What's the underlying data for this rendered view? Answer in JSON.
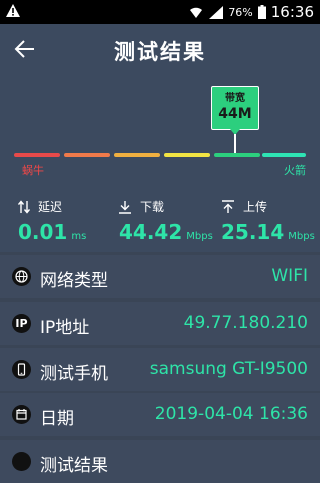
{
  "status_bar": {
    "battery": "76%",
    "time": "16:36"
  },
  "app_bar": {
    "title": "测试结果"
  },
  "gauge": {
    "bubble_label": "带宽",
    "bubble_value": "44M",
    "left_label": "蜗牛",
    "right_label": "火箭",
    "segment_colors": [
      "#e84a4a",
      "#f07a4a",
      "#f0b040",
      "#f2e443",
      "#2ccf7e",
      "#2ee4b4"
    ]
  },
  "stats": {
    "latency": {
      "label": "延迟",
      "value": "0.01",
      "unit": "ms"
    },
    "download": {
      "label": "下载",
      "value": "44.42",
      "unit": "Mbps"
    },
    "upload": {
      "label": "上传",
      "value": "25.14",
      "unit": "Mbps"
    }
  },
  "rows": [
    {
      "icon": "globe-icon",
      "label": "网络类型",
      "value": "WIFI"
    },
    {
      "icon": "ip-icon",
      "label": "IP地址",
      "value": "49.77.180.210"
    },
    {
      "icon": "phone-icon",
      "label": "测试手机",
      "value": "samsung GT-I9500"
    },
    {
      "icon": "calendar-icon",
      "label": "日期",
      "value": "2019-04-04 16:36"
    },
    {
      "icon": "result-icon",
      "label": "测试结果",
      "value": ""
    }
  ],
  "colors": {
    "accent": "#2ee4a8",
    "background": "#3a4556",
    "row_background": "#3e4a5e"
  }
}
